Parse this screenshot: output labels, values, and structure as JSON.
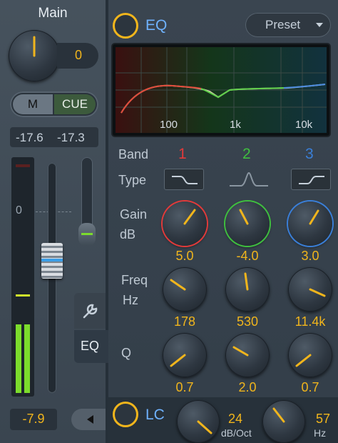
{
  "channel": {
    "name": "Main",
    "pan_value": "0",
    "mute_label": "M",
    "cue_label": "CUE",
    "level_left": "-17.6",
    "level_right": "-17.3",
    "meter_top_label": "0",
    "fader_value": "-7.9"
  },
  "side_tabs": {
    "eq_tab_label": "EQ",
    "wrench_icon": "wrench-icon"
  },
  "eq": {
    "title": "EQ",
    "preset_label": "Preset",
    "freq_ticks": [
      "100",
      "1k",
      "10k"
    ],
    "band_label": "Band",
    "type_label": "Type",
    "gain_label": "Gain",
    "gain_unit": "dB",
    "freq_label": "Freq",
    "freq_unit": "Hz",
    "q_label": "Q",
    "bands": [
      {
        "number": "1",
        "color": "#e23a3a",
        "type_icon": "low-shelf-icon",
        "gain": "5.0",
        "freq": "178",
        "q": "0.7"
      },
      {
        "number": "2",
        "color": "#3fbf3f",
        "type_icon": "bell-icon",
        "gain": "-4.0",
        "freq": "530",
        "q": "2.0"
      },
      {
        "number": "3",
        "color": "#3a7fd8",
        "type_icon": "high-shelf-icon",
        "gain": "3.0",
        "freq": "11.4k",
        "q": "0.7"
      }
    ]
  },
  "lc": {
    "title": "LC",
    "slope_value": "24",
    "slope_unit": "dB/Oct",
    "freq_value": "57",
    "freq_unit": "Hz"
  },
  "colors": {
    "accent": "#f1b51c",
    "meter_green": "#7cdc2c"
  }
}
